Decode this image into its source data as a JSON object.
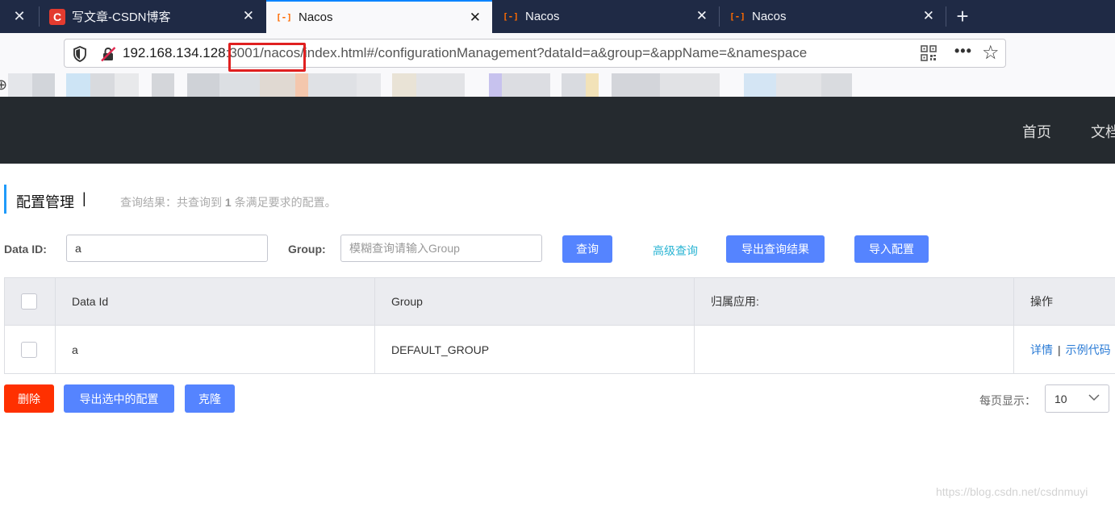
{
  "browser": {
    "tabs": [
      {
        "title": "写文章-CSDN博客",
        "favicon": "C",
        "active": false
      },
      {
        "title": "Nacos",
        "favicon": "[-]",
        "active": true
      },
      {
        "title": "Nacos",
        "favicon": "[-]",
        "active": false
      },
      {
        "title": "Nacos",
        "favicon": "[-]",
        "active": false
      }
    ],
    "close_glyph": "✕",
    "new_tab_glyph": "+",
    "url": {
      "host": "192.168.134.128",
      "rest": ":3001/nacos/index.html#/configurationManagement?dataId=a&group=&appName=&namespace"
    },
    "more_glyph": "•••",
    "star_glyph": "☆",
    "globe_glyph": "⊕"
  },
  "header": {
    "nav": [
      "首页",
      "文档"
    ]
  },
  "page": {
    "title": "配置管理",
    "title_sep": "|",
    "result_prefix": "查询结果：共查询到",
    "result_count": "1",
    "result_suffix": "条满足要求的配置。"
  },
  "search": {
    "dataid_label": "Data ID:",
    "dataid_value": "a",
    "group_label": "Group:",
    "group_placeholder": "模糊查询请输入Group",
    "query_btn": "查询",
    "advanced_link": "高级查询",
    "export_btn": "导出查询结果",
    "import_btn": "导入配置"
  },
  "table": {
    "columns": [
      "Data Id",
      "Group",
      "归属应用:",
      "操作"
    ],
    "rows": [
      {
        "data_id": "a",
        "group": "DEFAULT_GROUP",
        "app": "",
        "op_detail": "详情",
        "op_sep": "|",
        "op_sample": "示例代码"
      }
    ]
  },
  "footer": {
    "delete_btn": "删除",
    "export_selected_btn": "导出选中的配置",
    "clone_btn": "克隆",
    "page_size_label": "每页显示：",
    "page_size": "10"
  },
  "watermark": "https://blog.csdn.net/csdnmuyi",
  "colors": {
    "primary": "#5584ff",
    "danger": "#ff3000",
    "link": "#2a7bd6",
    "header_bg": "#252a2f",
    "tabstrip_bg": "#1f2a45",
    "highlight": "#e02020"
  }
}
